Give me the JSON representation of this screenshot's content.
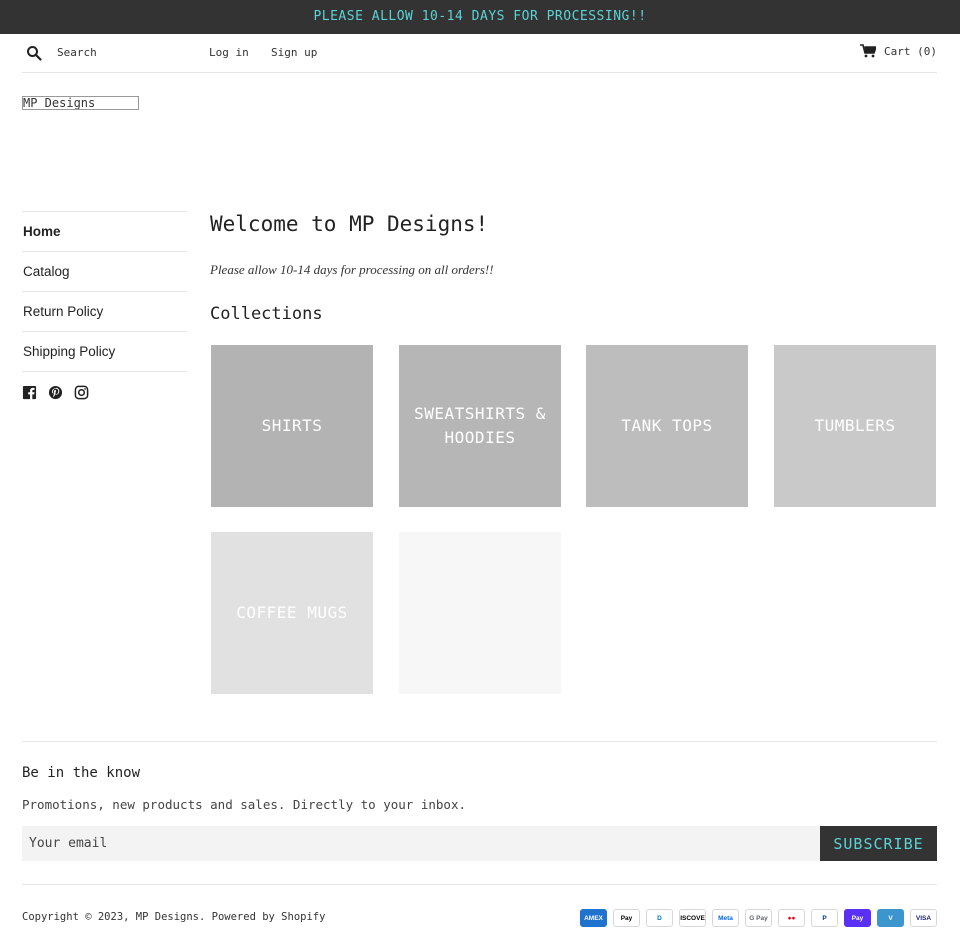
{
  "announcement": "PLEASE ALLOW 10-14 DAYS FOR PROCESSING!!",
  "header": {
    "search_placeholder": "Search",
    "login": "Log in",
    "signup": "Sign up",
    "cart": "Cart (0)"
  },
  "logo_text": "MP Designs",
  "nav": {
    "items": [
      {
        "label": "Home",
        "active": true
      },
      {
        "label": "Catalog",
        "active": false
      },
      {
        "label": "Return Policy",
        "active": false
      },
      {
        "label": "Shipping Policy",
        "active": false
      }
    ],
    "socials": [
      "facebook-icon",
      "pinterest-icon",
      "instagram-icon"
    ]
  },
  "main": {
    "title": "Welcome to MP Designs!",
    "note": "Please allow 10-14 days for processing on all orders!!",
    "collections_title": "Collections",
    "collections": [
      {
        "label": "SHIRTS",
        "bg": "#b3b3b3"
      },
      {
        "label": "SWEATSHIRTS & HOODIES",
        "bg": "#b6b6b6"
      },
      {
        "label": "TANK TOPS",
        "bg": "#bdbdbd"
      },
      {
        "label": "TUMBLERS",
        "bg": "#c9c9c9"
      },
      {
        "label": "COFFEE MUGS",
        "bg": "#e1e1e1"
      },
      {
        "label": "",
        "bg": "#f7f7f7"
      }
    ]
  },
  "footer": {
    "title": "Be in the know",
    "subtitle": "Promotions, new products and sales. Directly to your inbox.",
    "email_placeholder": "Your email",
    "subscribe": "SUBSCRIBE",
    "copyright": "Copyright © 2023, MP Designs. Powered by Shopify",
    "payments": [
      {
        "name": "AMEX",
        "bg": "#1f72cd",
        "fg": "#ffffff"
      },
      {
        "name": "Pay",
        "bg": "#ffffff",
        "fg": "#000000"
      },
      {
        "name": "D",
        "bg": "#ffffff",
        "fg": "#0079be"
      },
      {
        "name": "DISCOVER",
        "bg": "#ffffff",
        "fg": "#000000"
      },
      {
        "name": "Meta",
        "bg": "#ffffff",
        "fg": "#0668e1"
      },
      {
        "name": "G Pay",
        "bg": "#ffffff",
        "fg": "#5f6368"
      },
      {
        "name": "●●",
        "bg": "#ffffff",
        "fg": "#eb001b"
      },
      {
        "name": "P",
        "bg": "#ffffff",
        "fg": "#003087"
      },
      {
        "name": "Pay",
        "bg": "#5a31f4",
        "fg": "#ffffff"
      },
      {
        "name": "V",
        "bg": "#3d95ce",
        "fg": "#ffffff"
      },
      {
        "name": "VISA",
        "bg": "#ffffff",
        "fg": "#1a1f71"
      }
    ]
  },
  "colors": {
    "accent": "#5bd3d6",
    "dark": "#333333"
  }
}
